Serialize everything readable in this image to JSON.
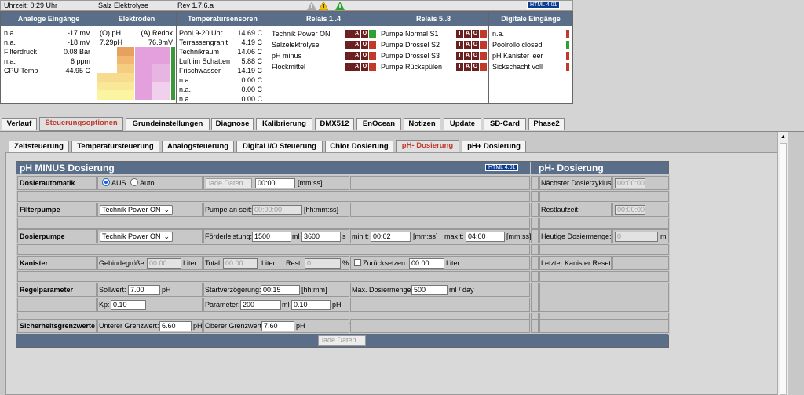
{
  "topbar": {
    "uptime": "Uhrzeit: 0:29 Uhr",
    "device": "Salz Elektrolyse",
    "rev": "Rev 1.7.6.a",
    "badge": "HTML 4.01"
  },
  "header": {
    "cols": [
      "Analoge Eingänge",
      "Elektroden",
      "Temperatursensoren",
      "Relais 1..4",
      "Relais 5..8",
      "Digitale Eingänge"
    ],
    "analog": [
      {
        "label": "n.a.",
        "value": "-17 mV"
      },
      {
        "label": "n.a.",
        "value": "-18 mV"
      },
      {
        "label": "Filterdruck",
        "value": "0.08 Bar"
      },
      {
        "label": "n.a.",
        "value": "6 ppm"
      },
      {
        "label": "CPU Temp",
        "value": "44.95 C"
      }
    ],
    "electrodes": {
      "ph_label": "(O) pH",
      "redox_label": "(A) Redox",
      "ph_value": "7.29pH",
      "redox_value": "76.9mV"
    },
    "temps": [
      {
        "label": "Pool 9-20 Uhr",
        "value": "14.69 C"
      },
      {
        "label": "Terrassengranit",
        "value": "4.19 C"
      },
      {
        "label": "Technikraum",
        "value": "14.06 C"
      },
      {
        "label": "Luft im Schatten",
        "value": "5.88 C"
      },
      {
        "label": "Frischwasser",
        "value": "14.19 C"
      },
      {
        "label": "n.a.",
        "value": "0.00 C"
      },
      {
        "label": "n.a.",
        "value": "0.00 C"
      },
      {
        "label": "n.a.",
        "value": "0.00 C"
      }
    ],
    "relais1": [
      "Technik Power ON",
      "Salzelektrolyse",
      "pH minus",
      "Flockmittel"
    ],
    "relais2": [
      "Pumpe Normal S1",
      "Pumpe Drossel S2",
      "Pumpe Drossel S3",
      "Pumpe Rückspülen"
    ],
    "iao": [
      "I",
      "A",
      "O"
    ],
    "digital": [
      "n.a.",
      "Poolrollo closed",
      "pH Kanister leer",
      "Sickschacht voll"
    ]
  },
  "main_tabs": [
    "Verlauf",
    "Steuerungsoptionen",
    "Grundeinstellungen",
    "Diagnose",
    "Kalibrierung",
    "DMX512",
    "EnOcean",
    "Notizen",
    "Update",
    "SD-Card",
    "Phase2"
  ],
  "sub_tabs": [
    "Zeitsteuerung",
    "Temperatursteuerung",
    "Analogsteuerung",
    "Digital I/O Steuerung",
    "Chlor Dosierung",
    "pH- Dosierung",
    "pH+ Dosierung"
  ],
  "form": {
    "title": "pH MINUS Dosierung",
    "right_title": "pH- Dosierung",
    "badge": "HTML 4.01",
    "dosierautomatik": {
      "label": "Dosierautomatik",
      "aus": "AUS",
      "auto": "Auto",
      "load_btn": "lade Daten...",
      "time": "00:00",
      "unit": "[mm:ss]",
      "next_label": "Nächster Dosierzyklus:",
      "next_val": "00:00:00"
    },
    "filterpumpe": {
      "label": "Filterpumpe",
      "select": "Technik Power ON",
      "pump_label": "Pumpe an seit:",
      "pump_val": "00:00:00",
      "unit": "[hh:mm:ss]",
      "rest_label": "Restlaufzeit:",
      "rest_val": "00:00:00"
    },
    "dosierpumpe": {
      "label": "Dosierpumpe",
      "select": "Technik Power ON",
      "feed_label": "Förderleistung:",
      "feed_val": "1500",
      "ml": "ml",
      "sec_val": "3600",
      "s": "s",
      "min_label": "min t:",
      "min_val": "00:02",
      "unit": "[mm:ss]",
      "max_label": "max t:",
      "max_val": "04:00",
      "today_label": "Heutige Dosiermenge:",
      "today_val": "0",
      "today_unit": "ml"
    },
    "kanister": {
      "label": "Kanister",
      "size_label": "Gebindegröße:",
      "size_val": "00.00",
      "liter": "Liter",
      "total_label": "Total:",
      "total_val": "00.00",
      "rest_label": "Rest:",
      "rest_val": "0",
      "pct": "%",
      "reset_label": "Zurücksetzen:",
      "reset_val": "00.00",
      "last_label": "Letzter Kanister Reset:"
    },
    "regel": {
      "label": "Regelparameter",
      "soll_label": "Sollwert:",
      "soll_val": "7.00",
      "ph": "pH",
      "start_label": "Startverzögerung:",
      "start_val": "00:15",
      "start_unit": "[hh:mm]",
      "max_label": "Max. Dosiermenge:",
      "max_val": "500",
      "max_unit": "ml / day",
      "kp_label": "Kp:",
      "kp_val": "0.10",
      "param_label": "Parameter:",
      "param_val": "200",
      "param_val2": "0.10",
      "ml": "ml"
    },
    "sicher": {
      "label": "Sicherheitsgrenzwerte",
      "lower_label": "Unterer Grenzwert:",
      "lower_val": "6.60",
      "upper_label": "Oberer Grenzwert:",
      "upper_val": "7.60",
      "ph": "pH"
    },
    "bottom_btn": "lade Daten..."
  }
}
